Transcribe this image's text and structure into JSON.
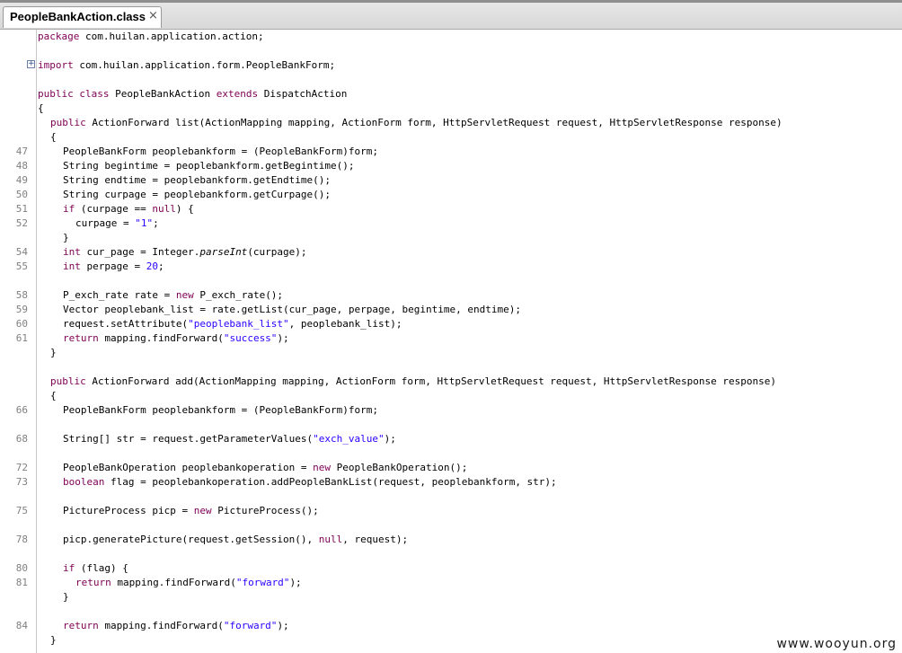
{
  "tab": {
    "title": "PeopleBankAction.class",
    "close_glyph": "×"
  },
  "fold_glyph": "+",
  "watermark": "www.wooyun.org",
  "colors": {
    "keyword": "#7f0055",
    "string": "#2a00ff",
    "line_number": "#808080"
  },
  "lines": [
    {
      "ln": "",
      "indent": 0,
      "tokens": [
        {
          "t": "package",
          "c": "kw"
        },
        {
          "t": " com.huilan.application.action;"
        }
      ]
    },
    {
      "ln": "",
      "indent": 0,
      "tokens": []
    },
    {
      "ln": "",
      "indent": 0,
      "fold": true,
      "tokens": [
        {
          "t": "import",
          "c": "kw"
        },
        {
          "t": " com.huilan.application.form.PeopleBankForm;"
        }
      ]
    },
    {
      "ln": "",
      "indent": 0,
      "tokens": []
    },
    {
      "ln": "",
      "indent": 0,
      "tokens": [
        {
          "t": "public",
          "c": "kw"
        },
        {
          "t": " "
        },
        {
          "t": "class",
          "c": "kw"
        },
        {
          "t": " PeopleBankAction "
        },
        {
          "t": "extends",
          "c": "kw"
        },
        {
          "t": " DispatchAction"
        }
      ]
    },
    {
      "ln": "",
      "indent": 0,
      "tokens": [
        {
          "t": "{"
        }
      ]
    },
    {
      "ln": "",
      "indent": 1,
      "tokens": [
        {
          "t": "public",
          "c": "kw"
        },
        {
          "t": " ActionForward list(ActionMapping mapping, ActionForm form, HttpServletRequest request, HttpServletResponse response)"
        }
      ]
    },
    {
      "ln": "",
      "indent": 1,
      "tokens": [
        {
          "t": "{"
        }
      ]
    },
    {
      "ln": "47",
      "indent": 2,
      "tokens": [
        {
          "t": "PeopleBankForm peoplebankform = (PeopleBankForm)form;"
        }
      ]
    },
    {
      "ln": "48",
      "indent": 2,
      "tokens": [
        {
          "t": "String begintime = peoplebankform.getBegintime();"
        }
      ]
    },
    {
      "ln": "49",
      "indent": 2,
      "tokens": [
        {
          "t": "String endtime = peoplebankform.getEndtime();"
        }
      ]
    },
    {
      "ln": "50",
      "indent": 2,
      "tokens": [
        {
          "t": "String curpage = peoplebankform.getCurpage();"
        }
      ]
    },
    {
      "ln": "51",
      "indent": 2,
      "tokens": [
        {
          "t": "if",
          "c": "kw"
        },
        {
          "t": " (curpage == "
        },
        {
          "t": "null",
          "c": "kw"
        },
        {
          "t": ") {"
        }
      ]
    },
    {
      "ln": "52",
      "indent": 3,
      "tokens": [
        {
          "t": "curpage = "
        },
        {
          "t": "\"1\"",
          "c": "str"
        },
        {
          "t": ";"
        }
      ]
    },
    {
      "ln": "",
      "indent": 2,
      "tokens": [
        {
          "t": "}"
        }
      ]
    },
    {
      "ln": "54",
      "indent": 2,
      "tokens": [
        {
          "t": "int",
          "c": "kw"
        },
        {
          "t": " cur_page = Integer."
        },
        {
          "t": "parseInt",
          "c": "ital"
        },
        {
          "t": "(curpage);"
        }
      ]
    },
    {
      "ln": "55",
      "indent": 2,
      "tokens": [
        {
          "t": "int",
          "c": "kw"
        },
        {
          "t": " perpage = "
        },
        {
          "t": "20",
          "c": "str"
        },
        {
          "t": ";"
        }
      ]
    },
    {
      "ln": "",
      "indent": 0,
      "tokens": []
    },
    {
      "ln": "58",
      "indent": 2,
      "tokens": [
        {
          "t": "P_exch_rate rate = "
        },
        {
          "t": "new",
          "c": "kw"
        },
        {
          "t": " P_exch_rate();"
        }
      ]
    },
    {
      "ln": "59",
      "indent": 2,
      "tokens": [
        {
          "t": "Vector peoplebank_list = rate.getList(cur_page, perpage, begintime, endtime);"
        }
      ]
    },
    {
      "ln": "60",
      "indent": 2,
      "tokens": [
        {
          "t": "request.setAttribute("
        },
        {
          "t": "\"peoplebank_list\"",
          "c": "str"
        },
        {
          "t": ", peoplebank_list);"
        }
      ]
    },
    {
      "ln": "61",
      "indent": 2,
      "tokens": [
        {
          "t": "return",
          "c": "kw"
        },
        {
          "t": " mapping.findForward("
        },
        {
          "t": "\"success\"",
          "c": "str"
        },
        {
          "t": ");"
        }
      ]
    },
    {
      "ln": "",
      "indent": 1,
      "tokens": [
        {
          "t": "}"
        }
      ]
    },
    {
      "ln": "",
      "indent": 0,
      "tokens": []
    },
    {
      "ln": "",
      "indent": 1,
      "tokens": [
        {
          "t": "public",
          "c": "kw"
        },
        {
          "t": " ActionForward add(ActionMapping mapping, ActionForm form, HttpServletRequest request, HttpServletResponse response)"
        }
      ]
    },
    {
      "ln": "",
      "indent": 1,
      "tokens": [
        {
          "t": "{"
        }
      ]
    },
    {
      "ln": "66",
      "indent": 2,
      "tokens": [
        {
          "t": "PeopleBankForm peoplebankform = (PeopleBankForm)form;"
        }
      ]
    },
    {
      "ln": "",
      "indent": 0,
      "tokens": []
    },
    {
      "ln": "68",
      "indent": 2,
      "tokens": [
        {
          "t": "String[] str = request.getParameterValues("
        },
        {
          "t": "\"exch_value\"",
          "c": "str"
        },
        {
          "t": ");"
        }
      ]
    },
    {
      "ln": "",
      "indent": 0,
      "tokens": []
    },
    {
      "ln": "72",
      "indent": 2,
      "tokens": [
        {
          "t": "PeopleBankOperation peoplebankoperation = "
        },
        {
          "t": "new",
          "c": "kw"
        },
        {
          "t": " PeopleBankOperation();"
        }
      ]
    },
    {
      "ln": "73",
      "indent": 2,
      "tokens": [
        {
          "t": "boolean",
          "c": "kw"
        },
        {
          "t": " flag = peoplebankoperation.addPeopleBankList(request, peoplebankform, str);"
        }
      ]
    },
    {
      "ln": "",
      "indent": 0,
      "tokens": []
    },
    {
      "ln": "75",
      "indent": 2,
      "tokens": [
        {
          "t": "PictureProcess picp = "
        },
        {
          "t": "new",
          "c": "kw"
        },
        {
          "t": " PictureProcess();"
        }
      ]
    },
    {
      "ln": "",
      "indent": 0,
      "tokens": []
    },
    {
      "ln": "78",
      "indent": 2,
      "tokens": [
        {
          "t": "picp.generatePicture(request.getSession(), "
        },
        {
          "t": "null",
          "c": "kw"
        },
        {
          "t": ", request);"
        }
      ]
    },
    {
      "ln": "",
      "indent": 0,
      "tokens": []
    },
    {
      "ln": "80",
      "indent": 2,
      "tokens": [
        {
          "t": "if",
          "c": "kw"
        },
        {
          "t": " (flag) {"
        }
      ]
    },
    {
      "ln": "81",
      "indent": 3,
      "tokens": [
        {
          "t": "return",
          "c": "kw"
        },
        {
          "t": " mapping.findForward("
        },
        {
          "t": "\"forward\"",
          "c": "str"
        },
        {
          "t": ");"
        }
      ]
    },
    {
      "ln": "",
      "indent": 2,
      "tokens": [
        {
          "t": "}"
        }
      ]
    },
    {
      "ln": "",
      "indent": 0,
      "tokens": []
    },
    {
      "ln": "84",
      "indent": 2,
      "tokens": [
        {
          "t": "return",
          "c": "kw"
        },
        {
          "t": " mapping.findForward("
        },
        {
          "t": "\"forward\"",
          "c": "str"
        },
        {
          "t": ");"
        }
      ]
    },
    {
      "ln": "",
      "indent": 1,
      "tokens": [
        {
          "t": "}"
        }
      ]
    }
  ]
}
